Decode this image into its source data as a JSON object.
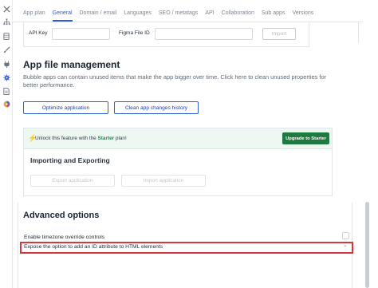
{
  "sidebar": {
    "icons": [
      "tools-icon",
      "sitemap-icon",
      "database-icon",
      "brush-icon",
      "plugin-icon",
      "gear-icon",
      "document-icon",
      "palette-icon"
    ],
    "active_icon": "gear-icon"
  },
  "tabs": [
    {
      "label": "App plan",
      "active": false
    },
    {
      "label": "General",
      "active": true
    },
    {
      "label": "Domain / email",
      "active": false
    },
    {
      "label": "Languages",
      "active": false
    },
    {
      "label": "SEO / metatags",
      "active": false
    },
    {
      "label": "API",
      "active": false
    },
    {
      "label": "Collaboration",
      "active": false
    },
    {
      "label": "Sub apps",
      "active": false
    },
    {
      "label": "Versions",
      "active": false
    }
  ],
  "api_section": {
    "api_key_label": "API Key",
    "api_key_value": "",
    "figma_label": "Figma File ID",
    "figma_value": "",
    "import_button": "Import"
  },
  "file_management": {
    "title": "App file management",
    "description": "Bubble apps can contain unused items that make the app bigger over time. Click here to clean unused properties for better performance.",
    "optimize_button": "Optimize application",
    "clean_button": "Clean app changes history"
  },
  "import_export": {
    "banner_prefix": "Unlock this feature with the ",
    "banner_plan": "Starter",
    "banner_suffix": " plan!",
    "upgrade_button": "Upgrade to Starter",
    "title": "Importing and Exporting",
    "export_button": "Export application",
    "import_button": "Import application"
  },
  "advanced": {
    "title": "Advanced options",
    "options": [
      {
        "label": "Enable timezone override controls",
        "checked": false
      },
      {
        "label": "Expose the option to add an ID attribute to HTML elements",
        "checked": false
      }
    ]
  },
  "colors": {
    "accent": "#2e5bd8",
    "upgrade_green": "#1e7a41",
    "highlight_red": "#d9363e"
  }
}
